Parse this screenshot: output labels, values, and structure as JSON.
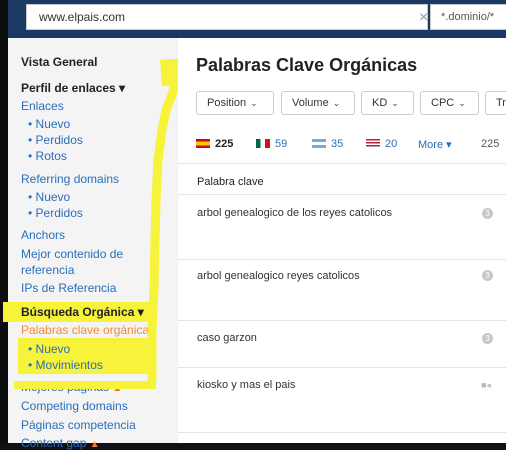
{
  "topbar": {
    "url_value": "www.elpais.com",
    "clear_glyph": "×",
    "mode_value": "*.dominio/*"
  },
  "sidebar": {
    "overview": "Vista General",
    "backlink_profile": "Perfil de enlaces ▾",
    "links": "Enlaces",
    "links_new": "• Nuevo",
    "links_lost": "• Perdidos",
    "links_broken": "• Rotos",
    "referring_domains": "Referring domains",
    "rd_new": "• Nuevo",
    "rd_lost": "• Perdidos",
    "anchors": "Anchors",
    "best_content_1": "Mejor contenido de",
    "best_content_2": "referencia",
    "ref_ips": "IPs de Referencia",
    "organic_search": "Búsqueda Orgánica ▾",
    "organic_keywords": "Palabras clave orgánicas",
    "ok_new": "• Nuevo",
    "ok_movements": "• Movimientos",
    "top_pages": "Mejores páginas",
    "competing_domains": "Competing domains",
    "competing_pages": "Páginas competencia",
    "content_gap": "Content gap"
  },
  "main": {
    "title": "Palabras Clave Orgánicas",
    "filters": [
      "Position",
      "Volume",
      "KD",
      "CPC",
      "Tr"
    ],
    "countries": [
      {
        "count": "225",
        "flag": "es-flag"
      },
      {
        "count": "59",
        "flag": "mx-flag"
      },
      {
        "count": "35",
        "flag": "ar-flag"
      },
      {
        "count": "20",
        "flag": "us-flag"
      }
    ],
    "more": "More ▾",
    "total": "225",
    "column_keyword": "Palabra clave",
    "rows": [
      {
        "keyword": "arbol genealogico de los reyes catolicos",
        "serp": "3"
      },
      {
        "keyword": "arbol genealogico reyes catolicos",
        "serp": "3"
      },
      {
        "keyword": "caso garzon",
        "serp": "3"
      },
      {
        "keyword": "kiosko y mas el pais",
        "serp": "■◂"
      }
    ]
  },
  "colors": {
    "highlight": "#f7f23a",
    "link": "#2a6ebb",
    "active": "#f48a33",
    "topbar": "#1a3a63"
  }
}
